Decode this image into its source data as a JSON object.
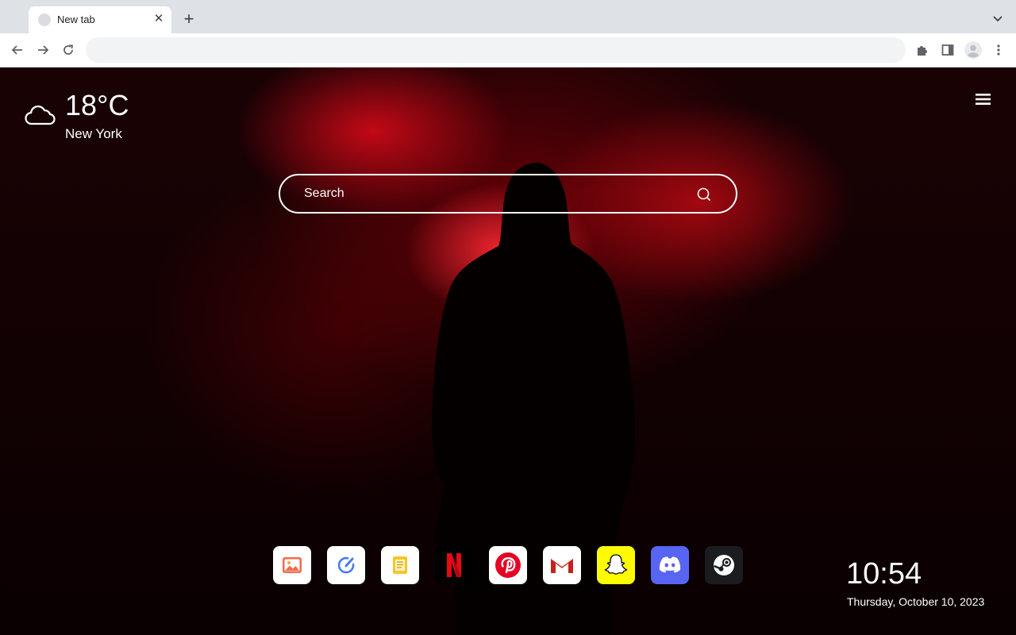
{
  "browser": {
    "tab": {
      "title": "New tab",
      "close_icon": "close-icon"
    },
    "new_tab_icon": "plus-icon",
    "omnibox": {
      "value": "",
      "placeholder": ""
    },
    "toolbar_icons": [
      "back-arrow-icon",
      "forward-arrow-icon",
      "reload-icon",
      "extensions-puzzle-icon",
      "side-panel-icon",
      "profile-avatar-icon",
      "more-vert-icon"
    ]
  },
  "weather": {
    "temperature": "18°C",
    "city": "New York",
    "icon": "cloud-icon"
  },
  "search": {
    "placeholder": "Search",
    "value": ""
  },
  "dock": {
    "apps": [
      {
        "name": "photos",
        "icon": "image-icon"
      },
      {
        "name": "edit",
        "icon": "pencil-circle-icon"
      },
      {
        "name": "notes",
        "icon": "note-icon"
      },
      {
        "name": "netflix",
        "icon": "netflix-icon"
      },
      {
        "name": "pinterest",
        "icon": "pinterest-icon"
      },
      {
        "name": "gmail",
        "icon": "gmail-icon"
      },
      {
        "name": "snapchat",
        "icon": "snapchat-icon"
      },
      {
        "name": "discord",
        "icon": "discord-icon"
      },
      {
        "name": "steam",
        "icon": "steam-icon"
      }
    ]
  },
  "clock": {
    "time": "10:54",
    "date": "Thursday, October 10, 2023"
  },
  "colors": {
    "accent_red": "#c8101c",
    "background": "#0a0001",
    "text": "#ffffff"
  }
}
